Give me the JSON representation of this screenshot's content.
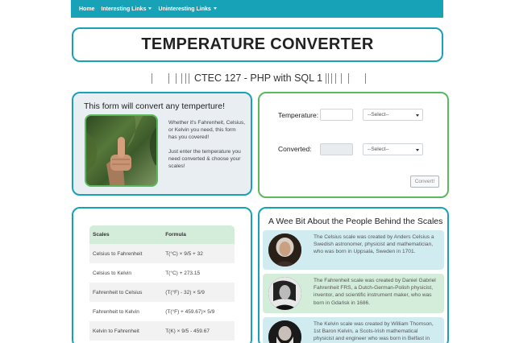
{
  "nav": {
    "home": "Home",
    "interesting": "Interesting Links",
    "uninteresting": "Uninteresting Links"
  },
  "title": "TEMPERATURE CONVERTER",
  "subtitle": "CTEC 127 - PHP with SQL 1",
  "info": {
    "heading": "This form will convert any temperture!",
    "text1": "Whether it's Fahrenheit, Celsius, or Kelvin you need, this form has you covered!",
    "text2": "Just enter the temperature you need converted & choose your scales!"
  },
  "form": {
    "temperature_label": "Temperature:",
    "converted_label": "Converted:",
    "select_placeholder": "--Select--",
    "convert_button": "Convert!"
  },
  "table": {
    "headers": [
      "Scales",
      "Formula"
    ],
    "rows": [
      [
        "Celsius to Fahrenheit",
        "T(°C) × 9/5 + 32"
      ],
      [
        "Celsius to Kelvin",
        "T(°C) + 273.15"
      ],
      [
        "Fahrenheit to Celsius",
        "(T(°F) - 32) × 5/9"
      ],
      [
        "Fahrenheit to Kelvin",
        "(T(°F) + 459.67)× 5/9"
      ],
      [
        "Kelvin to Fahrenheit",
        "T(K) × 9/5 - 459.67"
      ]
    ]
  },
  "people": {
    "heading": "A Wee Bit About the People Behind the Scales",
    "celsius": "The Celsius scale was created by Anders Celsius a Swedish astronomer, physicist and mathematician, who was born in Uppsala, Sweden in 1701.",
    "fahrenheit": "The Fahrenheit scale was created by Daniel Gabriel Fahrenheit FRS, a Dutch-German-Polish physicist, inventor, and scientific instrument maker, who was born in Gdańsk in 1686.",
    "kelvin": "The Kelvin scale was created by William Thomson, 1st Baron Kelvin, a Scots-Irish mathematical physicist and engineer who was born in Belfast in"
  },
  "colors": {
    "teal": "#17a2b8",
    "green": "#5cb85c",
    "card_blue": "#d1ecf1",
    "card_green": "#d4edda"
  }
}
